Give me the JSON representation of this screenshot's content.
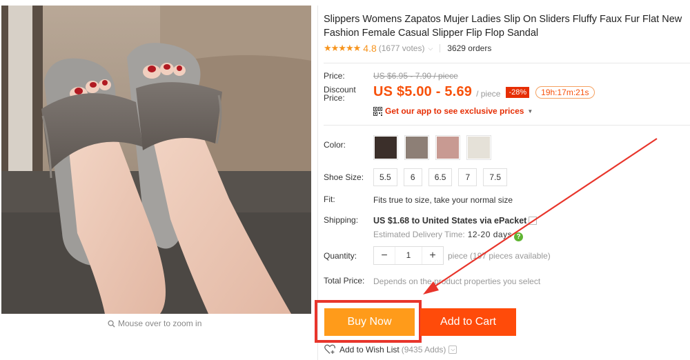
{
  "product": {
    "title": "Slippers Womens Zapatos Mujer Ladies Slip On Sliders Fluffy Faux Fur Flat New Fashion Female Casual Slipper Flip Flop Sandal",
    "stars": "★★★★★",
    "rating": "4.8",
    "votes": "(1677 votes)",
    "orders": "3629 orders",
    "zoom_hint": "Mouse over to zoom in"
  },
  "pricing": {
    "price_label": "Price:",
    "original_price": "US $6.95 - 7.90 / piece",
    "discount_label_line1": "Discount",
    "discount_label_line2": "Price:",
    "discount_price": "US $5.00 - 5.69",
    "unit": "/ piece",
    "discount_badge": "-28%",
    "timer": "19h:17m:21s",
    "app_promo": "Get our app to see exclusive prices"
  },
  "options": {
    "color_label": "Color:",
    "colors": [
      {
        "name": "black",
        "hex": "#3b2f2a"
      },
      {
        "name": "gray",
        "hex": "#8d7f76"
      },
      {
        "name": "pink",
        "hex": "#c89a92"
      },
      {
        "name": "white",
        "hex": "#e5e1d8"
      }
    ],
    "size_label": "Shoe Size:",
    "sizes": [
      "5.5",
      "6",
      "6.5",
      "7",
      "7.5"
    ],
    "fit_label": "Fit:",
    "fit_value": "Fits true to size, take your normal size",
    "shipping_label": "Shipping:",
    "shipping_value": "US $1.68 to United States via ePacket",
    "delivery_label": "Estimated Delivery Time:",
    "delivery_value": "12-20 days",
    "quantity_label": "Quantity:",
    "quantity_value": "1",
    "quantity_minus": "−",
    "quantity_plus": "+",
    "availability": "piece (197 pieces available)",
    "total_label": "Total Price:",
    "total_value": "Depends on the product properties you select"
  },
  "actions": {
    "buy_now": "Buy Now",
    "add_to_cart": "Add to Cart",
    "wish_label": "Add to Wish List",
    "wish_count": "(9435 Adds)"
  },
  "colors": {
    "accent_orange": "#f7510b",
    "buy_button": "#ff9b1a",
    "cart_button": "#ff4b0a",
    "highlight_red": "#e8352b"
  }
}
